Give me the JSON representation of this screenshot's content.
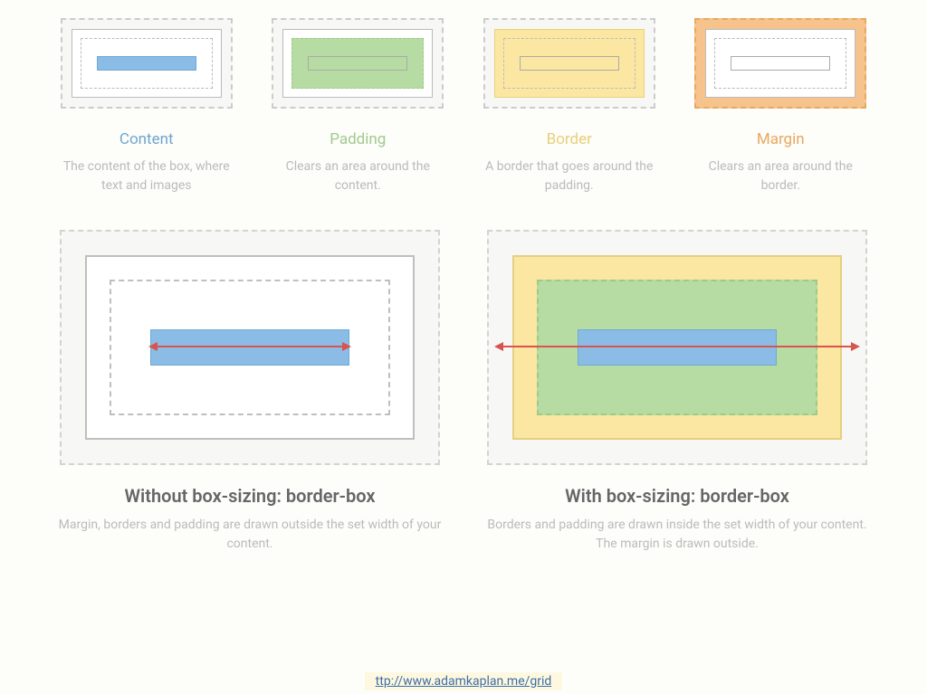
{
  "topCards": [
    {
      "title": "Content",
      "desc": "The content of the box, where text and images",
      "titleClass": "t-blue",
      "highlight": "hi-content"
    },
    {
      "title": "Padding",
      "desc": "Clears an area around the content.",
      "titleClass": "t-green",
      "highlight": "hi-padding"
    },
    {
      "title": "Border",
      "desc": "A border that goes around the padding.",
      "titleClass": "t-yellow",
      "highlight": "hi-border"
    },
    {
      "title": "Margin",
      "desc": "Clears an area around the border.",
      "titleClass": "t-orange",
      "highlight": "hi-margin"
    }
  ],
  "bottom": {
    "without": {
      "title": "Without box-sizing: border-box",
      "desc": "Margin, borders and padding are drawn outside the set width of your content."
    },
    "with": {
      "title": "With box-sizing: border-box",
      "desc": "Borders and padding are drawn inside the set width of your content. The margin is drawn outside."
    }
  },
  "footer": {
    "label": "ttp://www.adamkaplan.me/grid"
  }
}
